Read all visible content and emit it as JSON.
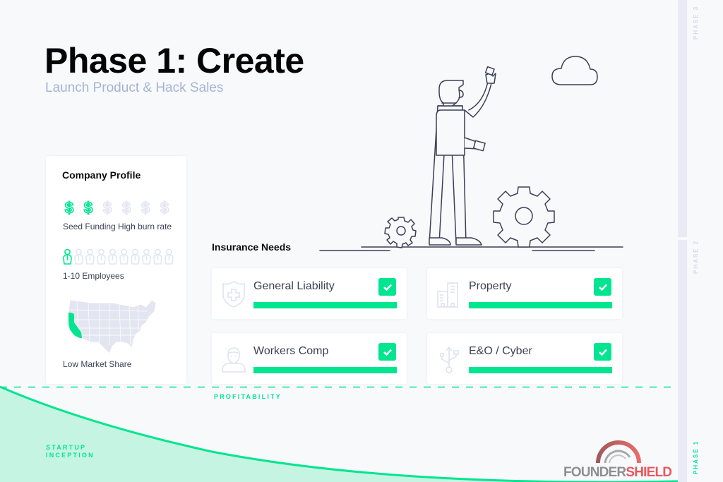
{
  "header": {
    "title": "Phase 1: Create",
    "subtitle": "Launch Product & Hack Sales"
  },
  "company_profile": {
    "title": "Company Profile",
    "funding": {
      "icon": "dollar-icon",
      "filled": 2,
      "total": 6,
      "label": "Seed Funding High burn rate"
    },
    "employees": {
      "icon": "person-icon",
      "filled": 1,
      "total": 10,
      "label": "1-10 Employees"
    },
    "market": {
      "icon": "us-map-icon",
      "highlighted_state": "California",
      "label": "Low Market Share"
    }
  },
  "insurance_needs": {
    "title": "Insurance Needs",
    "items": [
      {
        "label": "General Liability",
        "icon": "shield-plus-icon",
        "checked": true,
        "progress": 1.0
      },
      {
        "label": "Property",
        "icon": "building-icon",
        "checked": true,
        "progress": 1.0
      },
      {
        "label": "Workers Comp",
        "icon": "worker-icon",
        "checked": true,
        "progress": 1.0
      },
      {
        "label": "E&O / Cyber",
        "icon": "usb-icon",
        "checked": true,
        "progress": 1.0
      }
    ]
  },
  "growth_curve": {
    "profitability_label": "PROFITABILITY",
    "startup_label_line1": "STARTUP",
    "startup_label_line2": "INCEPTION"
  },
  "phases": {
    "phase3": "PHASE 3",
    "phase2": "PHASE 2",
    "phase1": "PHASE 1",
    "active": "PHASE 1"
  },
  "logo": {
    "part1": "FOUNDER",
    "part2": "SHIELD"
  },
  "colors": {
    "accent": "#00e590",
    "accent_light": "#c5f5e2",
    "muted": "#e3e6f1",
    "text": "#3b3f55",
    "subtitle": "#a7b3d3",
    "logo_gray": "#8e8e8e",
    "logo_red": "#e8585c"
  }
}
